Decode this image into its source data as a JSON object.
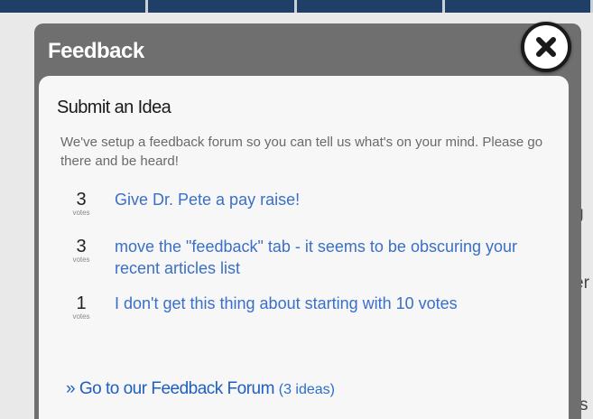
{
  "window": {
    "title": "Feedback",
    "close_icon": "close-icon"
  },
  "background_edge": {
    "texts": [
      "g",
      "er",
      "s"
    ]
  },
  "panel": {
    "heading": "Submit an Idea",
    "description": "We've setup a feedback forum so you can tell us what's on your mind. Please go there and be heard!"
  },
  "ideas": [
    {
      "votes": "3",
      "votes_label": "votes",
      "title": "Give Dr. Pete a pay raise!"
    },
    {
      "votes": "3",
      "votes_label": "votes",
      "title": "move the \"feedback\" tab - it seems to be obscuring your recent articles list"
    },
    {
      "votes": "1",
      "votes_label": "votes",
      "title": "I don't get this thing about starting with 10 votes"
    }
  ],
  "footer": {
    "link_label": "» Go to our Feedback Forum",
    "count_label": "(3 ideas)"
  },
  "colors": {
    "modal_frame": "#6f6f6f",
    "panel_bg": "#f7f7f7",
    "link": "#3a6fc7",
    "nav_bar": "#1f3f66"
  }
}
